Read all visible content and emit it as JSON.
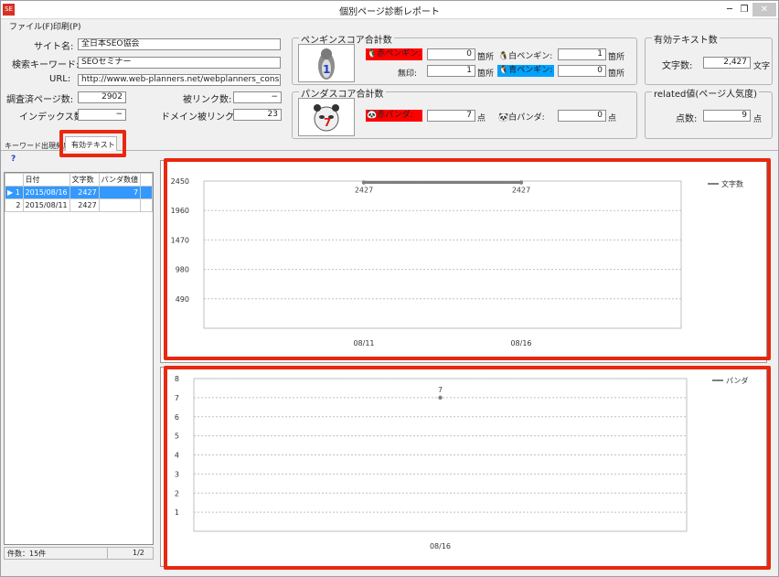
{
  "window": {
    "title": "個別ページ診断レポート",
    "app_icon_text": "SE",
    "min_glyph": "─",
    "max_glyph": "❐",
    "close_glyph": "✕"
  },
  "menu": {
    "file": "ファイル(F)",
    "print": "印刷(P)"
  },
  "info": {
    "site_label": "サイト名:",
    "site_value": "全日本SEO協会",
    "keyword_label": "検索キーワード:",
    "keyword_value": "SEOセミナー",
    "url_label": "URL:",
    "url_value": "http://www.web-planners.net/webplanners_consul",
    "surveyed_label": "調査済ページ数:",
    "surveyed_value": "2902",
    "backlinks_label": "被リンク数:",
    "backlinks_value": "−",
    "index_label": "インデックス数:",
    "index_value": "−",
    "domain_links_label": "ドメイン被リンク:",
    "domain_links_value": "23"
  },
  "penguin": {
    "group_title": "ペンギンスコア合計数",
    "mascot_number": "1",
    "red_label": "赤ペンギン:",
    "red_value": "0",
    "white_label": "白ペンギン:",
    "white_value": "1",
    "none_label": "無印:",
    "none_value": "1",
    "blue_label": "青ペンギン:",
    "blue_value": "0",
    "unit": "箇所"
  },
  "panda": {
    "group_title": "パンダスコア合計数",
    "mascot_number": "7",
    "red_label": "赤パンダ:",
    "red_value": "7",
    "white_label": "白パンダ:",
    "white_value": "0",
    "unit": "点"
  },
  "effective_text": {
    "group_title": "有効テキスト数",
    "chars_label": "文字数:",
    "chars_value": "2,427",
    "unit": "文字"
  },
  "related": {
    "group_title": "related値(ページ人気度)",
    "points_label": "点数:",
    "points_value": "9",
    "unit": "点"
  },
  "tabs": {
    "keyword": "キーワード出現頻度",
    "effective": "有効テキスト",
    "help": "?"
  },
  "table": {
    "headers": [
      "日付",
      "文字数",
      "パンダ数値"
    ],
    "rows": [
      {
        "no": "1",
        "date": "2015/08/16",
        "chars": "2427",
        "panda": "7"
      },
      {
        "no": "2",
        "date": "2015/08/11",
        "chars": "2427",
        "panda": ""
      }
    ],
    "row_marker": "▶"
  },
  "status": {
    "count": "件数：15件",
    "page": "1/2"
  },
  "chart_data": [
    {
      "type": "line",
      "categories": [
        "08/11",
        "08/16"
      ],
      "series": [
        {
          "name": "文字数",
          "values": [
            2427,
            2427
          ]
        }
      ],
      "yticks": [
        490,
        980,
        1470,
        1960,
        2450
      ],
      "ylim": [
        0,
        2450
      ],
      "data_labels": [
        "2427",
        "2427"
      ],
      "grid": true,
      "legend": "top-right",
      "color": "#7f7f7f"
    },
    {
      "type": "line",
      "categories": [
        "08/16"
      ],
      "series": [
        {
          "name": "パンダ",
          "values": [
            7
          ]
        }
      ],
      "yticks": [
        1,
        2,
        3,
        4,
        5,
        6,
        7,
        8
      ],
      "ylim": [
        0,
        8
      ],
      "data_labels": [
        "7"
      ],
      "grid": true,
      "legend": "top-right",
      "color": "#7f7f7f"
    }
  ],
  "colors": {
    "highlight_frame": "#e8280f",
    "selection": "#3399ff",
    "red_tag": "#ff0000",
    "blue_tag": "#00a2ff"
  }
}
